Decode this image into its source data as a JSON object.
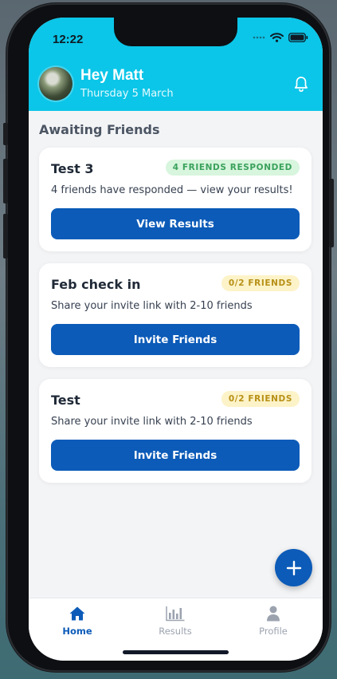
{
  "status_bar": {
    "time": "12:22"
  },
  "header": {
    "greeting": "Hey Matt",
    "date": "Thursday 5 March"
  },
  "section": {
    "title": "Awaiting Friends"
  },
  "cards": [
    {
      "title": "Test 3",
      "badge": "4 FRIENDS RESPONDED",
      "badge_color": "#3aa25c",
      "subtitle": "4 friends have responded — view your results!",
      "button": "View Results"
    },
    {
      "title": "Feb check in",
      "badge": "0/2 FRIENDS",
      "badge_color": "#b79016",
      "subtitle": "Share your invite link with 2-10 friends",
      "button": "Invite Friends"
    },
    {
      "title": "Test",
      "badge": "0/2 FRIENDS",
      "badge_color": "#b79016",
      "subtitle": "Share your invite link with 2-10 friends",
      "button": "Invite Friends"
    }
  ],
  "fab": {
    "icon": "plus-icon"
  },
  "tabs": [
    {
      "label": "Home",
      "icon": "home-icon",
      "active": true
    },
    {
      "label": "Results",
      "icon": "bar-chart-icon",
      "active": false
    },
    {
      "label": "Profile",
      "icon": "user-icon",
      "active": false
    }
  ],
  "colors": {
    "header": "#0bc6e8",
    "primary": "#0c5bb8",
    "background": "#f3f4f6"
  }
}
